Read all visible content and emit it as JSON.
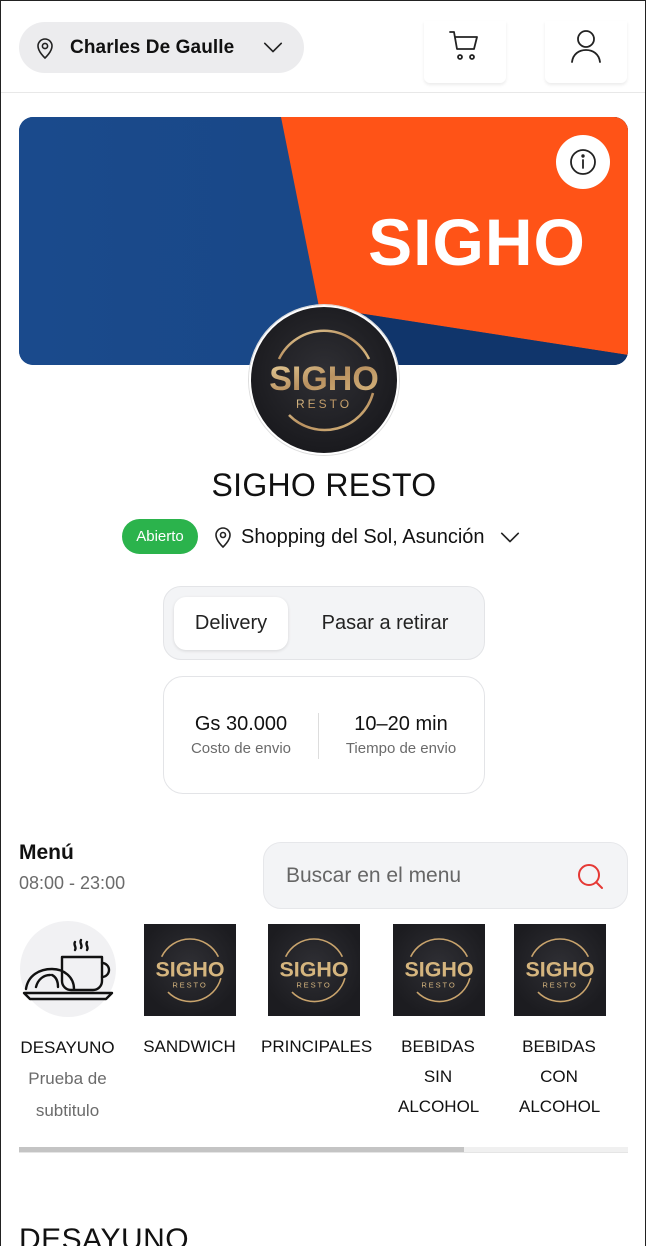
{
  "header": {
    "location": "Charles De Gaulle",
    "cart_icon": "cart-icon",
    "user_icon": "user-icon"
  },
  "banner": {
    "brand_text": "SIGHO",
    "colors": {
      "blue": "#1a4a8c",
      "orange": "#ff5317"
    }
  },
  "logo": {
    "top": "SIGHO",
    "bottom": "RESTO"
  },
  "restaurant": {
    "name": "SIGHO RESTO",
    "status": "Abierto",
    "branch": "Shopping del Sol, Asunción"
  },
  "delivery_mode": {
    "options": [
      "Delivery",
      "Pasar a retirar"
    ],
    "selected": "Delivery"
  },
  "info": {
    "cost_value": "Gs 30.000",
    "cost_label": "Costo de envio",
    "time_value": "10–20 min",
    "time_label": "Tiempo de envio"
  },
  "menu": {
    "title": "Menú",
    "hours": "08:00 - 23:00",
    "search_placeholder": "Buscar en el menu"
  },
  "categories": [
    {
      "name": "DESAYUNO",
      "subtitle": "Prueba de subtitulo",
      "image": "breakfast-icon"
    },
    {
      "name": "SANDWICH",
      "image": "logo"
    },
    {
      "name": "PRINCIPALES",
      "image": "logo"
    },
    {
      "name": "BEBIDAS SIN ALCOHOL",
      "image": "logo"
    },
    {
      "name": "BEBIDAS CON ALCOHOL",
      "image": "logo"
    }
  ],
  "scroll": {
    "position_fraction": 0.73
  },
  "section": {
    "title": "DESAYUNO"
  },
  "accent_colors": {
    "open_badge": "#2bb34c",
    "search_icon": "#e53935"
  }
}
